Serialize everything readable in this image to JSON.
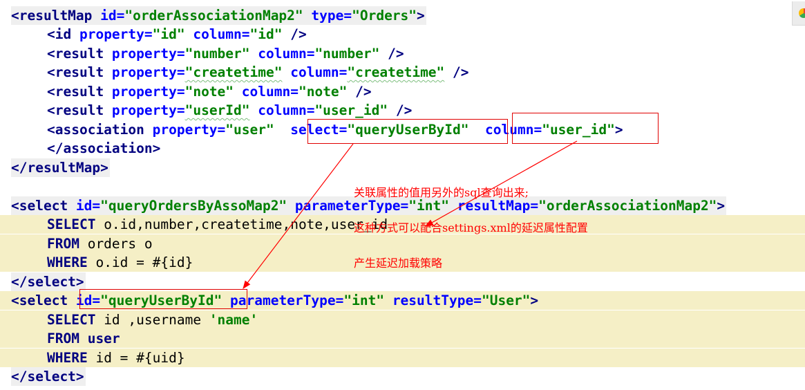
{
  "lines": [
    {
      "id": "l1",
      "tokens": [
        [
          "t",
          "<resultMap "
        ],
        [
          "a",
          "id="
        ],
        [
          "v",
          "\"orderAssociationMap2\""
        ],
        [
          "a",
          " type="
        ],
        [
          "v",
          "\"Orders\""
        ],
        [
          "t",
          ">"
        ]
      ]
    },
    {
      "id": "l2",
      "tokens": [
        [
          "t",
          "<id "
        ],
        [
          "a",
          "property="
        ],
        [
          "v",
          "\"id\""
        ],
        [
          "a",
          " column="
        ],
        [
          "v",
          "\"id\""
        ],
        [
          "t",
          " />"
        ]
      ]
    },
    {
      "id": "l3",
      "tokens": [
        [
          "t",
          "<result "
        ],
        [
          "a",
          "property="
        ],
        [
          "v",
          "\"number\""
        ],
        [
          "a",
          " column="
        ],
        [
          "v",
          "\"number\""
        ],
        [
          "t",
          " />"
        ]
      ]
    },
    {
      "id": "l4",
      "tokens": [
        [
          "t",
          "<result "
        ],
        [
          "a",
          "property="
        ],
        [
          "v",
          "\"createtime\""
        ],
        [
          "a",
          " column="
        ],
        [
          "v",
          "\"createtime\""
        ],
        [
          "t",
          " />"
        ]
      ]
    },
    {
      "id": "l5",
      "tokens": [
        [
          "t",
          "<result "
        ],
        [
          "a",
          "property="
        ],
        [
          "v",
          "\"note\""
        ],
        [
          "a",
          " column="
        ],
        [
          "v",
          "\"note\""
        ],
        [
          "t",
          " />"
        ]
      ]
    },
    {
      "id": "l6",
      "tokens": [
        [
          "t",
          "<result "
        ],
        [
          "a",
          "property="
        ],
        [
          "v",
          "\"userId\""
        ],
        [
          "a",
          " column="
        ],
        [
          "v",
          "\"user_id\""
        ],
        [
          "t",
          " />"
        ]
      ]
    },
    {
      "id": "l7",
      "tokens": [
        [
          "t",
          "<association "
        ],
        [
          "a",
          "property="
        ],
        [
          "v",
          "\"user\""
        ],
        [
          "t",
          "  "
        ],
        [
          "a",
          "select="
        ],
        [
          "v",
          "\"queryUserById\""
        ],
        [
          "t",
          "  "
        ],
        [
          "a",
          "column="
        ],
        [
          "v",
          "\"user_id\""
        ],
        [
          "t",
          ">"
        ]
      ]
    },
    {
      "id": "l8",
      "tokens": [
        [
          "t",
          "</association>"
        ]
      ]
    },
    {
      "id": "l9",
      "tokens": [
        [
          "t",
          "</resultMap>"
        ]
      ]
    },
    {
      "id": "l10",
      "tokens": []
    },
    {
      "id": "l11",
      "tokens": [
        [
          "t",
          "<select "
        ],
        [
          "a",
          "id="
        ],
        [
          "v",
          "\"queryOrdersByAssoMap2\""
        ],
        [
          "a",
          " parameterType="
        ],
        [
          "v",
          "\"int\""
        ],
        [
          "a",
          " resultMap="
        ],
        [
          "v",
          "\"orderAssociationMap2\""
        ],
        [
          "t",
          ">"
        ]
      ]
    },
    {
      "id": "l12",
      "tokens": [
        [
          "k",
          "SELECT "
        ],
        [
          "txt",
          "o.id,number,createtime,note,user_id"
        ]
      ]
    },
    {
      "id": "l13",
      "tokens": [
        [
          "k",
          "FROM "
        ],
        [
          "txt",
          "orders o"
        ]
      ]
    },
    {
      "id": "l14",
      "tokens": [
        [
          "k",
          "WHERE "
        ],
        [
          "txt",
          "o.id = #{id}"
        ]
      ]
    },
    {
      "id": "l15",
      "tokens": [
        [
          "t",
          "</select>"
        ]
      ]
    },
    {
      "id": "l16",
      "tokens": [
        [
          "t",
          "<select "
        ],
        [
          "a",
          "id="
        ],
        [
          "v",
          "\"queryUserById\""
        ],
        [
          "a",
          " parameterType="
        ],
        [
          "v",
          "\"int\""
        ],
        [
          "a",
          " resultType="
        ],
        [
          "v",
          "\"User\""
        ],
        [
          "t",
          ">"
        ]
      ]
    },
    {
      "id": "l17",
      "tokens": [
        [
          "k",
          "SELECT "
        ],
        [
          "txt",
          "id ,username "
        ],
        [
          "s",
          "'name'"
        ]
      ]
    },
    {
      "id": "l18",
      "tokens": [
        [
          "k",
          "FROM "
        ],
        [
          "k",
          "user"
        ]
      ]
    },
    {
      "id": "l19",
      "tokens": [
        [
          "k",
          "WHERE "
        ],
        [
          "txt",
          "id = #{uid}"
        ]
      ]
    },
    {
      "id": "l20",
      "tokens": [
        [
          "t",
          "</select>"
        ]
      ]
    }
  ],
  "annotation": {
    "line1": "关联属性的值用另外的sql查询出来;",
    "line2": "这种方式可以配合settings.xml的延迟属性配置",
    "line3": "产生延迟加载策略"
  },
  "colors": {
    "highlight": "#f5efc6",
    "tag": "#000080",
    "attr": "#0000ff",
    "value": "#008000",
    "annotation": "#ff0000"
  }
}
